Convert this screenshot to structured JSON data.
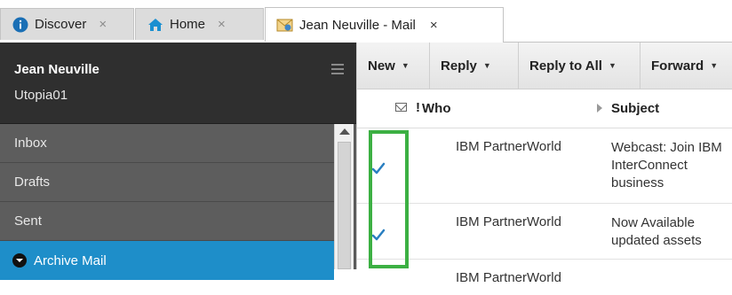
{
  "tabs": [
    {
      "label": "Discover",
      "icon": "info-icon",
      "close": "×"
    },
    {
      "label": "Home",
      "icon": "home-icon",
      "close": "×"
    },
    {
      "label": "Jean Neuville - Mail",
      "icon": "mail-icon",
      "close": "×"
    }
  ],
  "sidebar": {
    "user_name": "Jean Neuville",
    "server": "Utopia01",
    "folders": [
      "Inbox",
      "Drafts",
      "Sent",
      "Archive Mail"
    ],
    "selected_folder": "Archive Mail"
  },
  "toolbar": {
    "buttons": [
      "New",
      "Reply",
      "Reply to All",
      "Forward"
    ]
  },
  "columns": {
    "importance": "!",
    "who": "Who",
    "subject": "Subject"
  },
  "messages": [
    {
      "from": "IBM PartnerWorld",
      "subject": "Webcast: Join IBM InterConnect business",
      "checked": true
    },
    {
      "from": "IBM PartnerWorld",
      "subject": "Now Available updated assets",
      "checked": true
    },
    {
      "from": "IBM PartnerWorld",
      "subject": "",
      "checked": false
    }
  ],
  "colors": {
    "accent": "#1e8ec9",
    "highlight": "#3cb043",
    "check": "#2a7fc1"
  }
}
